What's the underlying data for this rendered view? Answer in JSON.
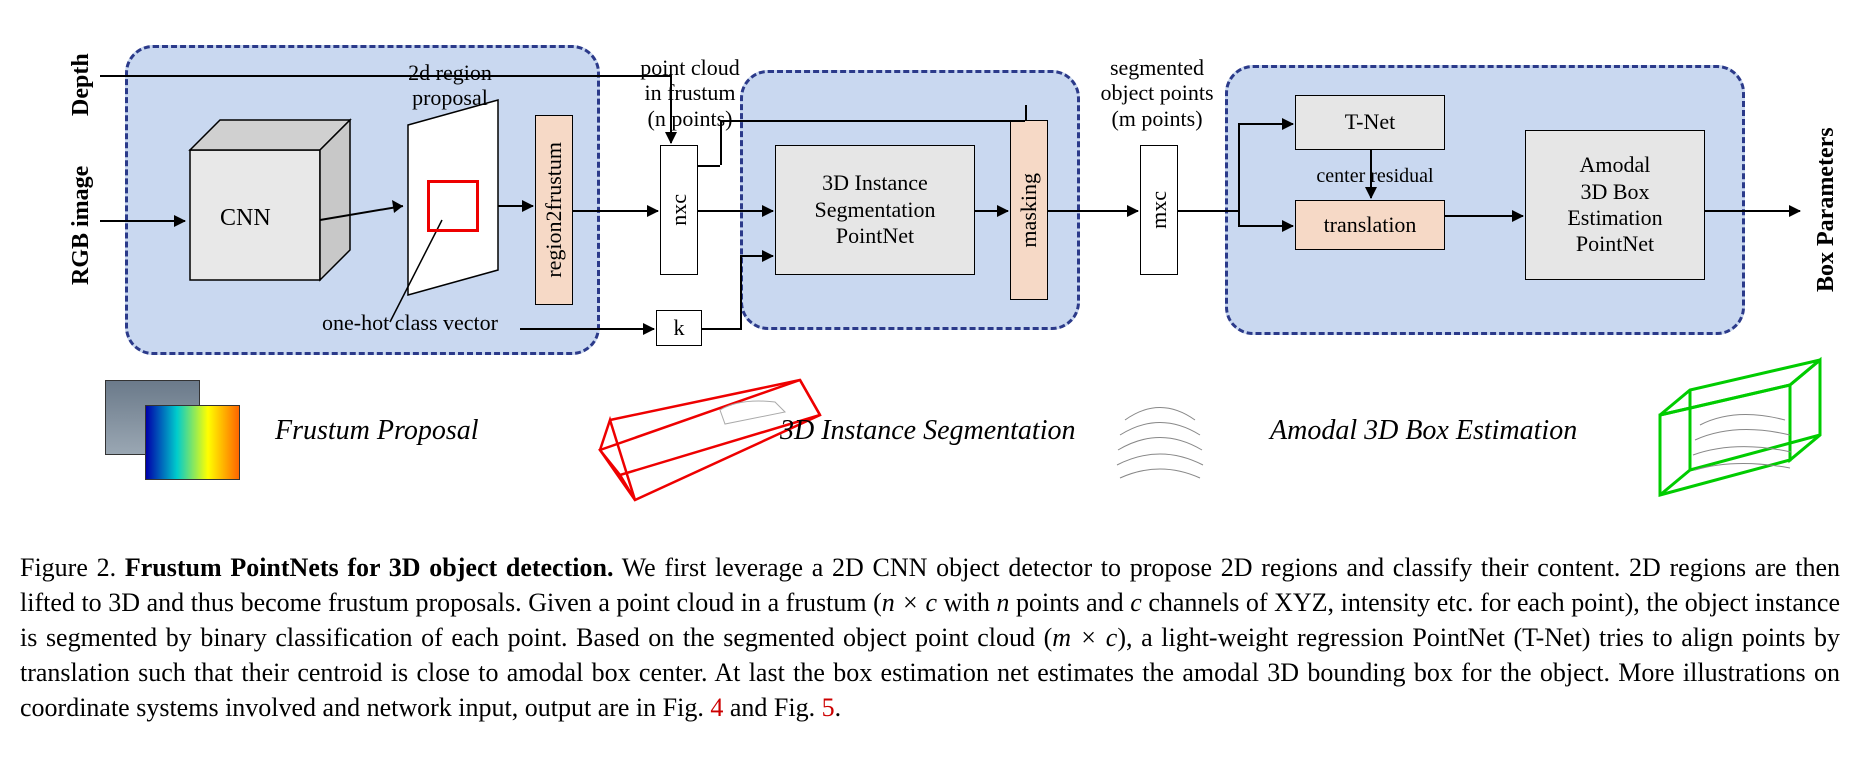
{
  "inputs": {
    "depth_label": "Depth",
    "rgb_label": "RGB image"
  },
  "output_label": "Box Parameters",
  "stage_titles": {
    "frustum": "Frustum Proposal",
    "segmentation": "3D Instance Segmentation",
    "estimation": "Amodal 3D Box Estimation"
  },
  "blocks": {
    "cnn": "CNN",
    "region_proposal_label": "2d region\nproposal",
    "region2frustum": "region2frustum",
    "one_hot_label": "one-hot class vector",
    "nxc": "nxc",
    "k": "k",
    "point_cloud_label": "point cloud\nin frustum\n(n points)",
    "seg_pointnet": "3D Instance\nSegmentation\nPointNet",
    "masking": "masking",
    "segmented_label": "segmented\nobject points\n(m points)",
    "mxc": "mxc",
    "tnet": "T-Net",
    "center_residual": "center residual",
    "translation": "translation",
    "amodal_box_net": "Amodal\n3D Box\nEstimation\nPointNet"
  },
  "caption": {
    "fig_label": "Figure 2.",
    "title": "Frustum PointNets for 3D object detection.",
    "body_1": " We first leverage a 2D CNN object detector to propose 2D regions and classify their content. 2D regions are then lifted to 3D and thus become frustum proposals. Given a point cloud in a frustum (",
    "math_1": "n × c",
    "body_2": " with ",
    "math_2": "n",
    "body_3": " points and ",
    "math_3": "c",
    "body_4": " channels of XYZ, intensity etc. for each point), the object instance is segmented by binary classification of each point. Based on the segmented object point cloud (",
    "math_4": "m × c",
    "body_5": "), a light-weight regression PointNet (T-Net) tries to align points by translation such that their centroid is close to amodal box center. At last the box estimation net estimates the amodal 3D bounding box for the object. More illustrations on coordinate systems involved and network input, output are in Fig. ",
    "ref_4": "4",
    "body_6": " and Fig. ",
    "ref_5": "5",
    "body_7": "."
  }
}
